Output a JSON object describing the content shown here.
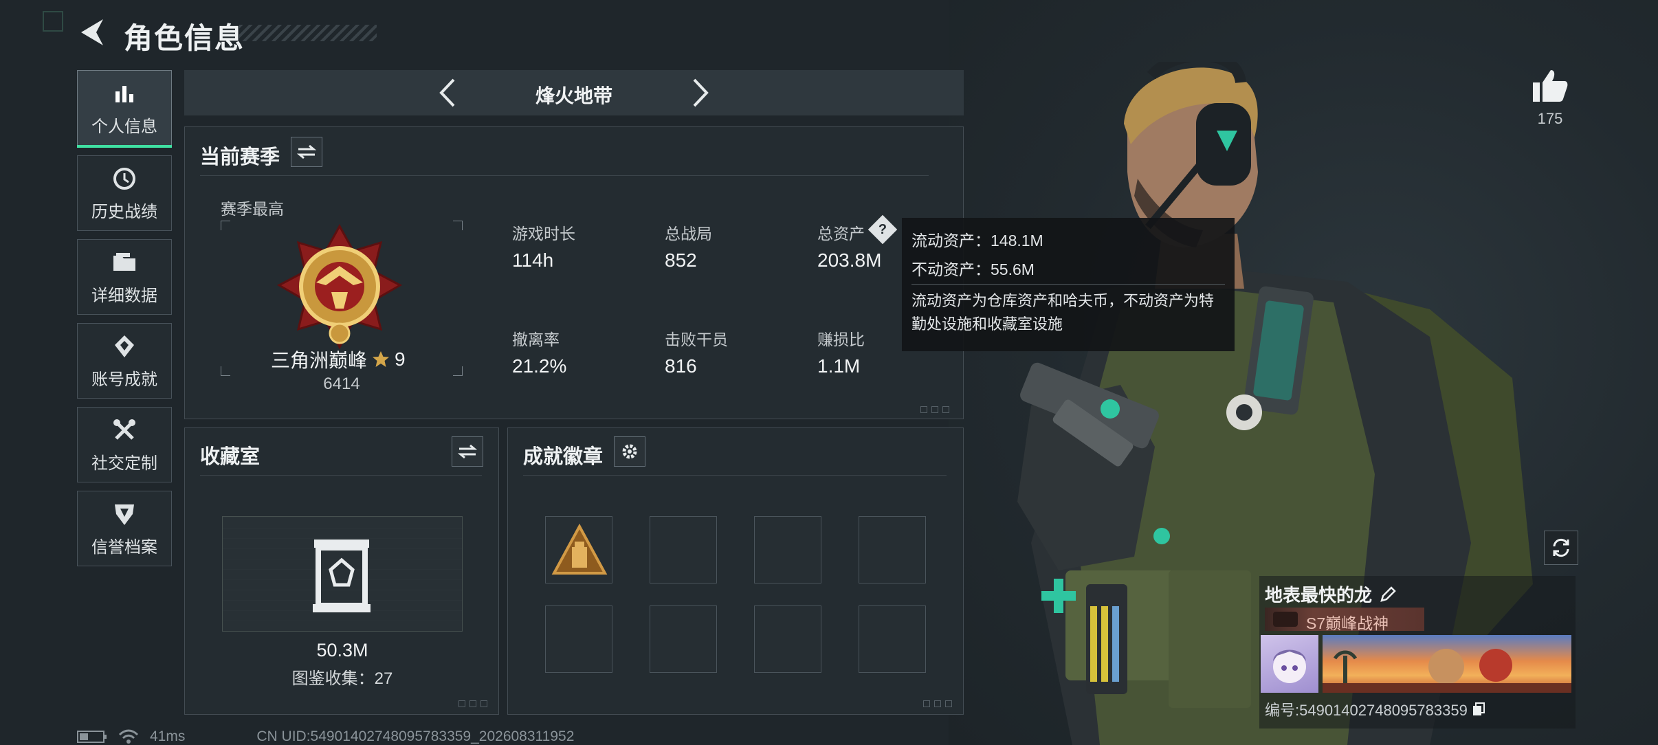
{
  "header": {
    "title": "角色信息"
  },
  "sidebar": {
    "items": [
      {
        "label": "个人信息",
        "icon": "bar-chart-icon",
        "active": true
      },
      {
        "label": "历史战绩",
        "icon": "history-icon"
      },
      {
        "label": "详细数据",
        "icon": "folder-icon"
      },
      {
        "label": "账号成就",
        "icon": "achievement-icon"
      },
      {
        "label": "社交定制",
        "icon": "tools-icon"
      },
      {
        "label": "信誉档案",
        "icon": "shield-icon"
      }
    ]
  },
  "mode": {
    "title": "烽火地带"
  },
  "season": {
    "title": "当前赛季",
    "best_label": "赛季最高",
    "rank_name": "三角洲巅峰",
    "rank_stars": "9",
    "rank_points": "6414",
    "stats": [
      {
        "label": "游戏时长",
        "value": "114h"
      },
      {
        "label": "总战局",
        "value": "852"
      },
      {
        "label": "总资产",
        "value": "203.8M"
      },
      {
        "label": "撤离率",
        "value": "21.2%"
      },
      {
        "label": "击败干员",
        "value": "816"
      },
      {
        "label": "赚损比",
        "value": "1.1M"
      }
    ]
  },
  "tooltip": {
    "liquid": "流动资产：148.1M",
    "fixed": "不动资产：55.6M",
    "note": "流动资产为仓库资产和哈夫币，不动资产为特勤处设施和收藏室设施"
  },
  "collection": {
    "title": "收藏室",
    "value": "50.3M",
    "count_text": "图鉴收集：27"
  },
  "badges": {
    "title": "成就徽章"
  },
  "likes": {
    "count": "175"
  },
  "profile": {
    "name": "地表最快的龙",
    "banner_title": "S7巅峰战神",
    "id_text": "编号:549014027480957833​59"
  },
  "status": {
    "latency": "41ms",
    "uid": "CN UID:54901402748095783359_202608311952"
  },
  "colors": {
    "accent": "#3fe0a2",
    "gold": "#d4a64a"
  }
}
